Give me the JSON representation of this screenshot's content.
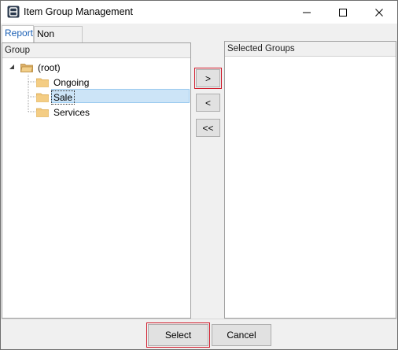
{
  "window": {
    "title": "Item Group Management",
    "accent_color": "#d01b2b"
  },
  "tabs": [
    {
      "label": "Report",
      "active": true
    },
    {
      "label": "Non Report",
      "active": false
    }
  ],
  "left_panel": {
    "header": "Group",
    "tree": {
      "root": {
        "label": "(root)",
        "expanded": true,
        "icon": "folder-open-icon"
      },
      "children": [
        {
          "label": "Ongoing",
          "icon": "folder-icon",
          "selected": false
        },
        {
          "label": "Sale",
          "icon": "folder-icon",
          "selected": true
        },
        {
          "label": "Services",
          "icon": "folder-icon",
          "selected": false
        }
      ]
    }
  },
  "transfer_buttons": {
    "add": ">",
    "remove": "<",
    "remove_all": "<<"
  },
  "right_panel": {
    "header": "Selected Groups",
    "items": []
  },
  "footer": {
    "select_label": "Select",
    "cancel_label": "Cancel"
  }
}
